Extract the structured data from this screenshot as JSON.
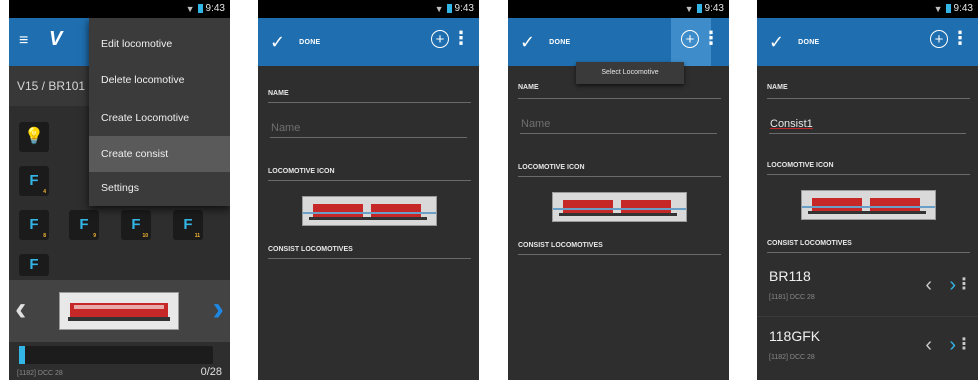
{
  "status": {
    "time": "9:43"
  },
  "colors": {
    "actionbar": "#1f6fb0",
    "accent": "#33b5e5",
    "background": "#2e2e2e"
  },
  "icons": {
    "check": "✓",
    "add": "+",
    "more": "⋮",
    "prev": "‹",
    "next": "›",
    "menu": "≡",
    "logo": "V"
  },
  "screen1": {
    "loco_title": "V15 / BR101",
    "menu": [
      "Edit locomotive",
      "Delete locomotive",
      "Create Locomotive",
      "Create consist",
      "Settings"
    ],
    "functions": [
      "",
      "4",
      "8",
      "9",
      "10",
      "11",
      ""
    ],
    "speed_value": 0,
    "bottom_left": "[1182] DCC 28",
    "bottom_right": "0/28"
  },
  "editor": {
    "done_label": "DONE",
    "name_label": "NAME",
    "name_placeholder": "Name",
    "icon_label": "LOCOMOTIVE ICON",
    "consist_label": "CONSIST LOCOMOTIVES"
  },
  "screen3": {
    "toast": "Select Locomotive"
  },
  "screen4": {
    "name_value": "Consist1",
    "items": [
      {
        "name": "BR118",
        "sub": "[1181] DCC 28"
      },
      {
        "name": "118GFK",
        "sub": "[1182] DCC 28"
      }
    ]
  }
}
